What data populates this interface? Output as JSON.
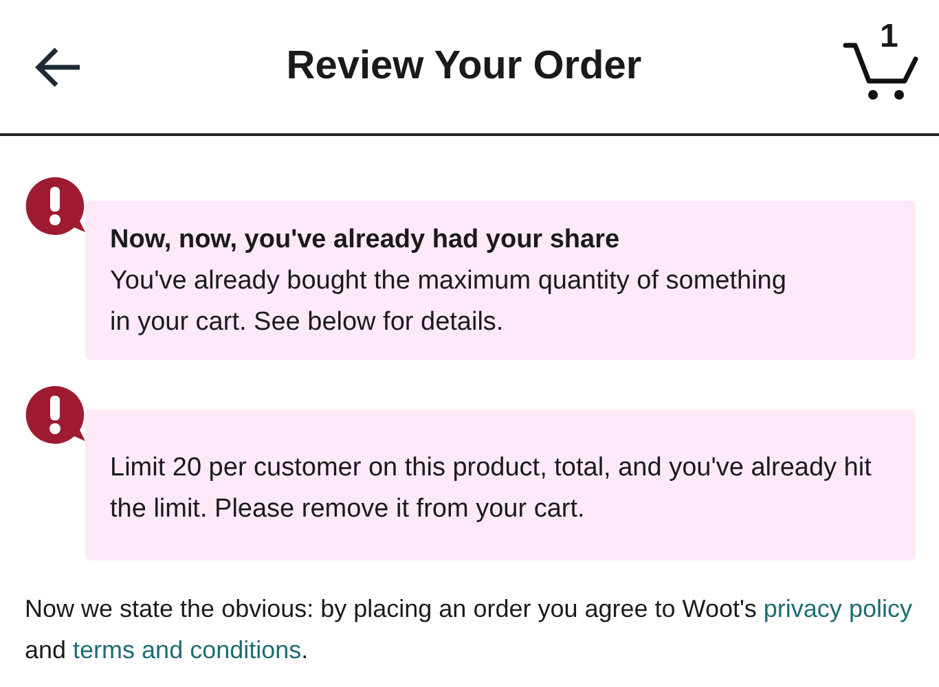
{
  "header": {
    "title": "Review Your Order",
    "cart_count": "1"
  },
  "alerts": [
    {
      "title": "Now, now, you've already had your share",
      "message": "You've already bought the maximum quantity of something in your cart. See below for details."
    },
    {
      "message": "Limit 20 per customer on this product, total, and you've already hit the limit. Please remove it from your cart."
    }
  ],
  "legal": [
    {
      "kind": "text",
      "text": "Now we state the obvious: by placing an order you agree to Woot's "
    },
    {
      "kind": "link",
      "text": "privacy policy"
    },
    {
      "kind": "text",
      "text": " and "
    },
    {
      "kind": "link",
      "text": "terms and conditions"
    },
    {
      "kind": "text",
      "text": "."
    }
  ]
}
